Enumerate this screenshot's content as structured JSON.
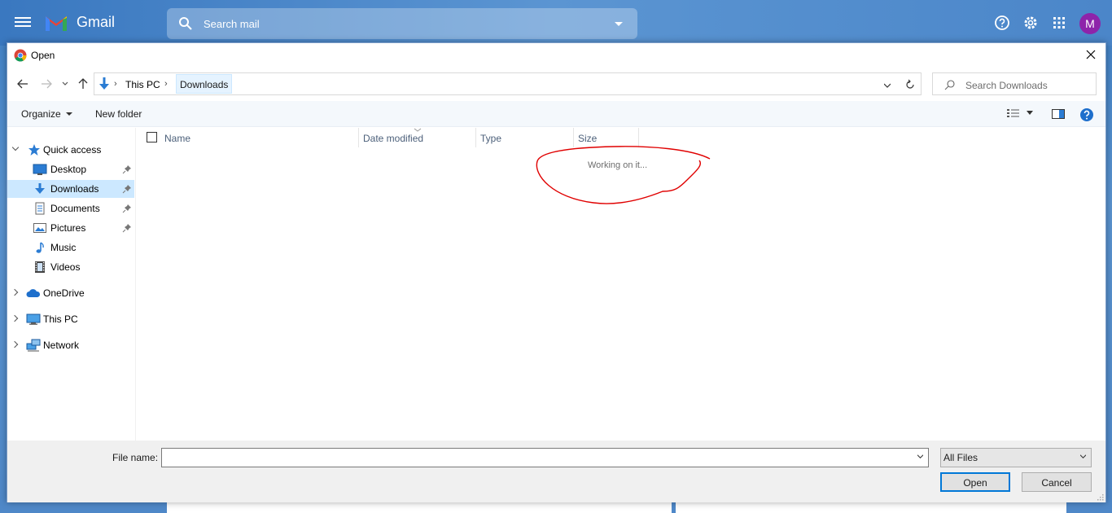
{
  "gmail": {
    "app_name": "Gmail",
    "search_placeholder": "Search mail",
    "avatar_letter": "M"
  },
  "dialog": {
    "title": "Open",
    "breadcrumb": [
      "This PC",
      "Downloads"
    ],
    "search_placeholder": "Search Downloads",
    "toolbar": {
      "organize": "Organize",
      "new_folder": "New folder"
    },
    "tree": {
      "quick_access": "Quick access",
      "items": [
        {
          "label": "Desktop",
          "pinned": true
        },
        {
          "label": "Downloads",
          "pinned": true,
          "selected": true
        },
        {
          "label": "Documents",
          "pinned": true
        },
        {
          "label": "Pictures",
          "pinned": true
        },
        {
          "label": "Music",
          "pinned": false
        },
        {
          "label": "Videos",
          "pinned": false
        }
      ],
      "onedrive": "OneDrive",
      "this_pc": "This PC",
      "network": "Network"
    },
    "columns": [
      "Name",
      "Date modified",
      "Type",
      "Size"
    ],
    "status": "Working on it...",
    "file_name_label": "File name:",
    "file_name_value": "",
    "file_type": "All Files",
    "open_button": "Open",
    "cancel_button": "Cancel"
  },
  "colors": {
    "accent": "#0078d7",
    "selection": "#cce8ff",
    "annotation": "#e00000",
    "avatar": "#8e24aa"
  }
}
